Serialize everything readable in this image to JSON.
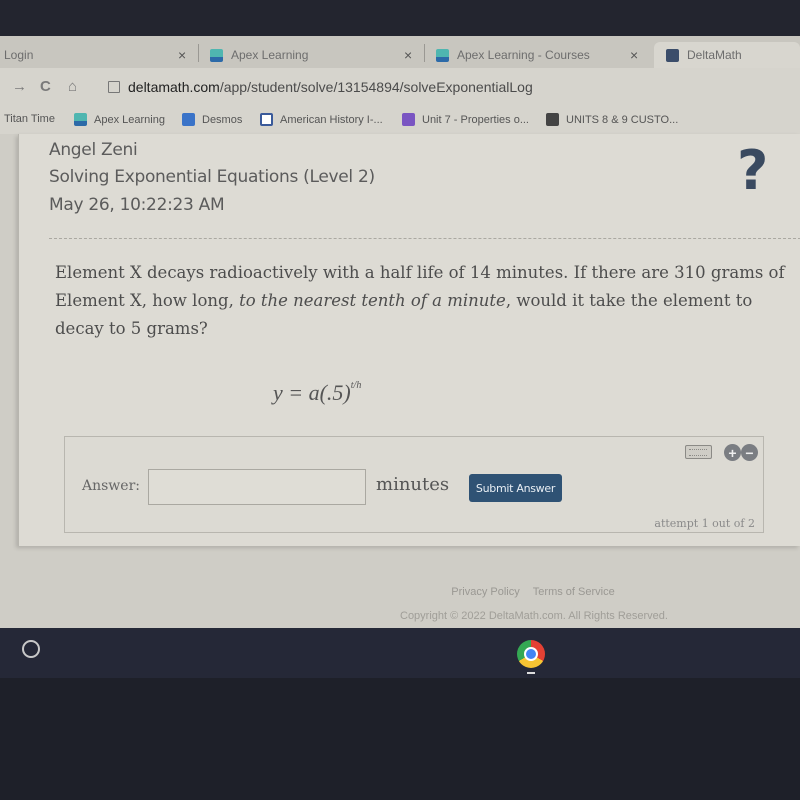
{
  "browser": {
    "tabs": [
      {
        "label": "Login",
        "favicon": "none",
        "active": false
      },
      {
        "label": "Apex Learning",
        "favicon": "apex-icon",
        "active": false
      },
      {
        "label": "Apex Learning - Courses",
        "favicon": "apex-icon",
        "active": false
      },
      {
        "label": "DeltaMath",
        "favicon": "deltamath-icon",
        "active": true
      }
    ],
    "close_glyph": "×",
    "nav": {
      "forward": "→",
      "reload": "C",
      "home": "⌂"
    },
    "url": {
      "domain": "deltamath.com",
      "path": "/app/student/solve/13154894/solveExponentialLog"
    },
    "bookmarks": [
      {
        "label": "Titan Time",
        "icon": "none"
      },
      {
        "label": "Apex Learning",
        "icon": "apex-icon"
      },
      {
        "label": "Desmos",
        "icon": "desmos-icon"
      },
      {
        "label": "American History I-...",
        "icon": "book-icon"
      },
      {
        "label": "Unit 7 - Properties o...",
        "icon": "list-icon"
      },
      {
        "label": "UNITS 8 & 9 CUSTO...",
        "icon": "person-icon"
      }
    ]
  },
  "header": {
    "student_name": "Angel Zeni",
    "skill": "Solving Exponential Equations (Level 2)",
    "timestamp": "May 26, 10:22:23 AM",
    "help_icon": "?"
  },
  "problem": {
    "text_before": "Element X decays radioactively with a half life of 14 minutes. If there are 310 grams of Element X, how long, ",
    "text_emphasis": "to the nearest tenth of a minute",
    "text_after": ", would it take the element to decay to 5 grams?",
    "formula_main": "y = a(.5)",
    "formula_exponent": "t/h"
  },
  "answer": {
    "label": "Answer:",
    "value": "",
    "unit": "minutes",
    "submit_label": "Submit Answer",
    "zoom_in": "+",
    "zoom_out": "−",
    "attempt_text": "attempt 1 out of 2"
  },
  "footer": {
    "privacy": "Privacy Policy",
    "terms": "Terms of Service",
    "copyright": "Copyright © 2022 DeltaMath.com. All Rights Reserved."
  },
  "colors": {
    "submit_button": "#2f5274",
    "help_icon": "#3a4a60"
  }
}
